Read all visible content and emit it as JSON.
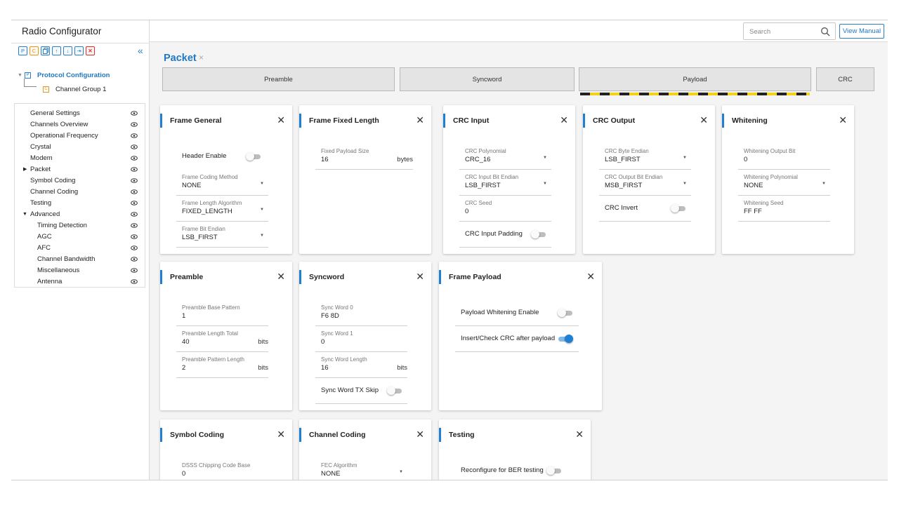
{
  "app": {
    "title": "Radio Configurator"
  },
  "header": {
    "search_placeholder": "Search",
    "view_manual": "View Manual"
  },
  "tree": {
    "protocol": "Protocol Configuration",
    "protocol_icon": "P",
    "channel_group": "Channel Group 1",
    "channel_icon": "C"
  },
  "toolbar": [
    "P",
    "C",
    "copy",
    "up",
    "down",
    "export",
    "delete"
  ],
  "nav": [
    "General Settings",
    "Channels Overview",
    "Operational Frequency",
    "Crystal",
    "Modem",
    "Packet",
    "Symbol Coding",
    "Channel Coding",
    "Testing",
    "Advanced",
    "Timing Detection",
    "AGC",
    "AFC",
    "Channel Bandwidth",
    "Miscellaneous",
    "Antenna"
  ],
  "page": {
    "title": "Packet",
    "close": "×"
  },
  "tabs": [
    "Preamble",
    "Syncword",
    "Payload",
    "CRC"
  ],
  "cards": {
    "frame_general": {
      "title": "Frame General",
      "header_enable": "Header Enable",
      "coding_label": "Frame Coding Method",
      "coding_value": "NONE",
      "length_label": "Frame Length Algorithm",
      "length_value": "FIXED_LENGTH",
      "endian_label": "Frame Bit Endian",
      "endian_value": "LSB_FIRST"
    },
    "frame_fixed_length": {
      "title": "Frame Fixed Length",
      "size_label": "Fixed Payload Size",
      "size_value": "16",
      "size_unit": "bytes"
    },
    "crc_input": {
      "title": "CRC Input",
      "poly_label": "CRC Polynomial",
      "poly_value": "CRC_16",
      "endian_label": "CRC Input Bit Endian",
      "endian_value": "LSB_FIRST",
      "seed_label": "CRC Seed",
      "seed_value": "0",
      "padding": "CRC Input Padding"
    },
    "crc_output": {
      "title": "CRC Output",
      "byte_label": "CRC Byte Endian",
      "byte_value": "LSB_FIRST",
      "bit_label": "CRC Output Bit Endian",
      "bit_value": "MSB_FIRST",
      "invert": "CRC Invert"
    },
    "whitening": {
      "title": "Whitening",
      "bit_label": "Whitening Output Bit",
      "bit_value": "0",
      "poly_label": "Whitening Polynomial",
      "poly_value": "NONE",
      "seed_label": "Whitening Seed",
      "seed_value": "FF FF"
    },
    "preamble": {
      "title": "Preamble",
      "base_label": "Preamble Base Pattern",
      "base_value": "1",
      "total_label": "Preamble Length Total",
      "total_value": "40",
      "total_unit": "bits",
      "pattern_label": "Preamble Pattern Length",
      "pattern_value": "2",
      "pattern_unit": "bits"
    },
    "syncword": {
      "title": "Syncword",
      "w0_label": "Sync Word 0",
      "w0_value": "F6 8D",
      "w1_label": "Sync Word 1",
      "w1_value": "0",
      "len_label": "Sync Word Length",
      "len_value": "16",
      "len_unit": "bits",
      "tx_skip": "Sync Word TX Skip"
    },
    "frame_payload": {
      "title": "Frame Payload",
      "whitening_enable": "Payload Whitening Enable",
      "insert_crc": "Insert/Check CRC after payload"
    },
    "symbol_coding": {
      "title": "Symbol Coding",
      "dsss_label": "DSSS Chipping Code Base",
      "dsss_value": "0"
    },
    "channel_coding": {
      "title": "Channel Coding",
      "fec_label": "FEC Algorithm",
      "fec_value": "NONE"
    },
    "testing": {
      "title": "Testing",
      "reconfigure": "Reconfigure for BER testing"
    }
  },
  "toggles": {
    "header_enable": false,
    "crc_input_padding": false,
    "crc_invert": false,
    "sync_tx_skip": false,
    "payload_whitening": false,
    "insert_crc": true,
    "ber_testing": false
  },
  "colors": {
    "accent": "#1f7fd0",
    "link": "#2178c4",
    "tree_orange": "#e29a1e",
    "delete_red": "#d9302c"
  }
}
